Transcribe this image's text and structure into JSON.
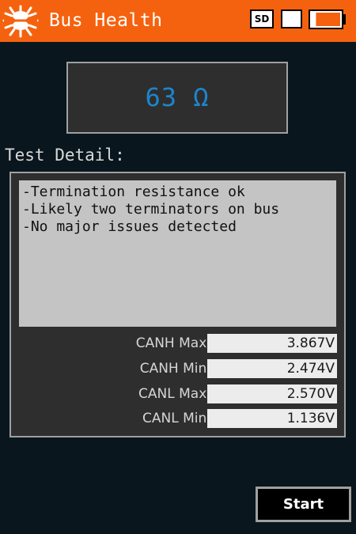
{
  "header": {
    "title": "Bus Health",
    "logo_icon": "can-bug-logo-icon",
    "sd_label": "SD",
    "battery_icon": "battery-icon",
    "battery_level": 0.85,
    "colors": {
      "background": "#f5620f",
      "battery_fill": "#f5620f"
    }
  },
  "readout": {
    "value": "63 Ω",
    "color": "#1e84cc"
  },
  "detail": {
    "label": "Test Detail:",
    "notes": [
      "-Termination resistance ok",
      "-Likely two terminators on bus",
      "-No major issues detected"
    ],
    "readings": [
      {
        "label": "CANH Max:",
        "value": "3.867V"
      },
      {
        "label": "CANH Min:",
        "value": "2.474V"
      },
      {
        "label": "CANL Max:",
        "value": "2.570V"
      },
      {
        "label": "CANL Min:",
        "value": "1.136V"
      }
    ]
  },
  "actions": {
    "start_label": "Start"
  }
}
